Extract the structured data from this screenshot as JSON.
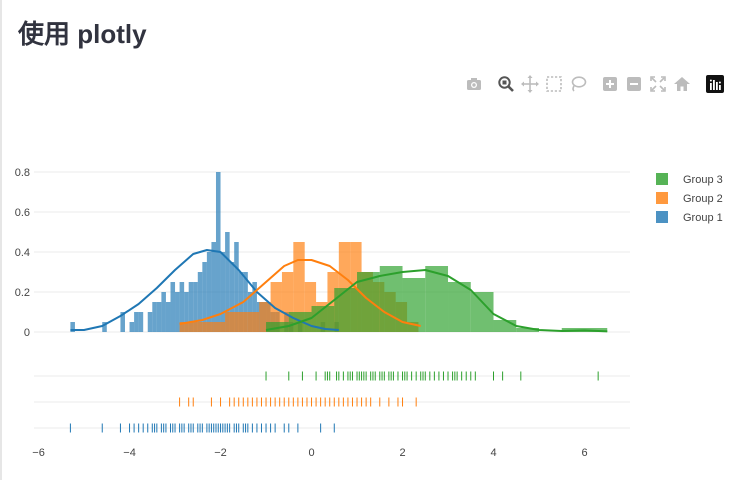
{
  "page": {
    "title": "使用 plotly"
  },
  "modebar": {
    "buttons": [
      {
        "name": "camera-icon",
        "label": "Download plot as a png"
      },
      {
        "name": "zoom-icon",
        "label": "Zoom"
      },
      {
        "name": "pan-icon",
        "label": "Pan"
      },
      {
        "name": "box-select-icon",
        "label": "Box Select"
      },
      {
        "name": "lasso-select-icon",
        "label": "Lasso Select"
      },
      {
        "name": "zoom-in-icon",
        "label": "Zoom in"
      },
      {
        "name": "zoom-out-icon",
        "label": "Zoom out"
      },
      {
        "name": "autoscale-icon",
        "label": "Autoscale"
      },
      {
        "name": "home-icon",
        "label": "Reset axes"
      },
      {
        "name": "plotly-logo-icon",
        "label": "Produced with Plotly"
      }
    ]
  },
  "chart_data": {
    "type": "histogram",
    "title": "",
    "xlabel": "",
    "ylabel": "",
    "xlim": [
      -6.1,
      7.0
    ],
    "ylim": [
      -0.02,
      0.86
    ],
    "x_ticks": [
      -6,
      -4,
      -2,
      0,
      2,
      4,
      6
    ],
    "y_ticks": [
      0,
      0.2,
      0.4,
      0.6,
      0.8
    ],
    "y_tick_labels": [
      "0",
      "0.2",
      "0.4",
      "0.6",
      "0.8"
    ],
    "grid": true,
    "legend_position": "right",
    "series": [
      {
        "name": "Group 3",
        "color": "#2ca02c",
        "bin_width": 0.5,
        "bins": [
          [
            -1.0,
            0.05
          ],
          [
            -0.5,
            0.1
          ],
          [
            0.0,
            0.13
          ],
          [
            0.5,
            0.22
          ],
          [
            1.0,
            0.3
          ],
          [
            1.5,
            0.33
          ],
          [
            2.0,
            0.27
          ],
          [
            2.5,
            0.33
          ],
          [
            3.0,
            0.25
          ],
          [
            3.5,
            0.2
          ],
          [
            4.0,
            0.06
          ],
          [
            4.5,
            0.02
          ],
          [
            5.5,
            0.02
          ],
          [
            6.0,
            0.02
          ]
        ],
        "kde": [
          [
            -1.0,
            0.01
          ],
          [
            -0.5,
            0.03
          ],
          [
            0.0,
            0.07
          ],
          [
            0.5,
            0.16
          ],
          [
            1.0,
            0.25
          ],
          [
            1.5,
            0.28
          ],
          [
            2.0,
            0.3
          ],
          [
            2.5,
            0.31
          ],
          [
            3.0,
            0.28
          ],
          [
            3.5,
            0.21
          ],
          [
            4.0,
            0.09
          ],
          [
            4.5,
            0.03
          ],
          [
            5.0,
            0.01
          ],
          [
            5.5,
            0.005
          ],
          [
            6.0,
            0.008
          ],
          [
            6.5,
            0.003
          ]
        ],
        "rug": [
          -1.0,
          -0.5,
          -0.2,
          0.1,
          0.3,
          0.35,
          0.4,
          0.55,
          0.6,
          0.7,
          0.8,
          0.85,
          0.9,
          1.0,
          1.05,
          1.1,
          1.15,
          1.2,
          1.3,
          1.35,
          1.4,
          1.5,
          1.55,
          1.6,
          1.7,
          1.75,
          1.8,
          1.9,
          2.0,
          2.05,
          2.1,
          2.2,
          2.3,
          2.4,
          2.45,
          2.5,
          2.6,
          2.7,
          2.8,
          2.9,
          3.0,
          3.1,
          3.15,
          3.2,
          3.3,
          3.4,
          3.5,
          3.6,
          4.0,
          4.2,
          4.6,
          6.3
        ]
      },
      {
        "name": "Group 2",
        "color": "#ff7f0e",
        "bin_width": 0.25,
        "bins": [
          [
            -2.9,
            0.05
          ],
          [
            -2.65,
            0.05
          ],
          [
            -2.4,
            0.05
          ],
          [
            -2.15,
            0.05
          ],
          [
            -1.9,
            0.1
          ],
          [
            -1.65,
            0.1
          ],
          [
            -1.4,
            0.1
          ],
          [
            -1.15,
            0.15
          ],
          [
            -0.9,
            0.25
          ],
          [
            -0.65,
            0.3
          ],
          [
            -0.4,
            0.45
          ],
          [
            -0.15,
            0.25
          ],
          [
            0.1,
            0.15
          ],
          [
            0.35,
            0.3
          ],
          [
            0.6,
            0.45
          ],
          [
            0.85,
            0.45
          ],
          [
            1.1,
            0.3
          ],
          [
            1.35,
            0.25
          ],
          [
            1.6,
            0.2
          ],
          [
            1.85,
            0.15
          ],
          [
            2.1,
            0.05
          ]
        ],
        "kde": [
          [
            -2.9,
            0.04
          ],
          [
            -2.4,
            0.06
          ],
          [
            -2.0,
            0.09
          ],
          [
            -1.5,
            0.15
          ],
          [
            -1.0,
            0.25
          ],
          [
            -0.6,
            0.33
          ],
          [
            -0.3,
            0.36
          ],
          [
            0.0,
            0.36
          ],
          [
            0.4,
            0.33
          ],
          [
            0.8,
            0.26
          ],
          [
            1.2,
            0.17
          ],
          [
            1.6,
            0.1
          ],
          [
            2.0,
            0.05
          ],
          [
            2.4,
            0.03
          ]
        ],
        "rug": [
          -2.9,
          -2.7,
          -2.6,
          -2.2,
          -2.0,
          -1.8,
          -1.7,
          -1.6,
          -1.5,
          -1.4,
          -1.3,
          -1.2,
          -1.1,
          -1.0,
          -0.9,
          -0.8,
          -0.7,
          -0.6,
          -0.5,
          -0.4,
          -0.3,
          -0.2,
          -0.1,
          0.0,
          0.1,
          0.2,
          0.3,
          0.4,
          0.5,
          0.6,
          0.7,
          0.8,
          0.9,
          1.0,
          1.1,
          1.2,
          1.3,
          1.5,
          1.7,
          1.9,
          2.0,
          2.3
        ]
      },
      {
        "name": "Group 1",
        "color": "#1f77b4",
        "bin_width": 0.1,
        "bins": [
          [
            -5.3,
            0.05
          ],
          [
            -4.6,
            0.05
          ],
          [
            -4.2,
            0.1
          ],
          [
            -4.0,
            0.05
          ],
          [
            -3.9,
            0.1
          ],
          [
            -3.8,
            0.1
          ],
          [
            -3.6,
            0.1
          ],
          [
            -3.5,
            0.15
          ],
          [
            -3.4,
            0.15
          ],
          [
            -3.3,
            0.2
          ],
          [
            -3.2,
            0.15
          ],
          [
            -3.1,
            0.25
          ],
          [
            -3.0,
            0.2
          ],
          [
            -2.9,
            0.25
          ],
          [
            -2.8,
            0.2
          ],
          [
            -2.7,
            0.25
          ],
          [
            -2.6,
            0.25
          ],
          [
            -2.5,
            0.3
          ],
          [
            -2.4,
            0.35
          ],
          [
            -2.3,
            0.4
          ],
          [
            -2.2,
            0.45
          ],
          [
            -2.1,
            0.8
          ],
          [
            -2.0,
            0.4
          ],
          [
            -1.9,
            0.5
          ],
          [
            -1.8,
            0.35
          ],
          [
            -1.7,
            0.45
          ],
          [
            -1.6,
            0.3
          ],
          [
            -1.5,
            0.3
          ],
          [
            -1.4,
            0.2
          ],
          [
            -1.3,
            0.25
          ],
          [
            -1.2,
            0.15
          ],
          [
            -1.1,
            0.15
          ],
          [
            -1.0,
            0.15
          ],
          [
            -0.9,
            0.1
          ],
          [
            -0.8,
            0.1
          ],
          [
            -0.6,
            0.1
          ],
          [
            -0.5,
            0.05
          ],
          [
            -0.3,
            0.05
          ],
          [
            0.2,
            0.05
          ],
          [
            0.5,
            0.05
          ]
        ],
        "kde": [
          [
            -5.3,
            0.01
          ],
          [
            -5.0,
            0.01
          ],
          [
            -4.6,
            0.03
          ],
          [
            -4.2,
            0.08
          ],
          [
            -3.8,
            0.14
          ],
          [
            -3.4,
            0.22
          ],
          [
            -3.0,
            0.31
          ],
          [
            -2.6,
            0.39
          ],
          [
            -2.3,
            0.41
          ],
          [
            -2.0,
            0.4
          ],
          [
            -1.6,
            0.31
          ],
          [
            -1.2,
            0.2
          ],
          [
            -0.8,
            0.12
          ],
          [
            -0.4,
            0.07
          ],
          [
            0.0,
            0.03
          ],
          [
            0.3,
            0.015
          ],
          [
            0.6,
            0.01
          ]
        ],
        "rug": [
          -5.3,
          -4.6,
          -4.2,
          -4.0,
          -3.9,
          -3.8,
          -3.7,
          -3.6,
          -3.5,
          -3.45,
          -3.4,
          -3.3,
          -3.25,
          -3.2,
          -3.1,
          -3.05,
          -3.0,
          -2.9,
          -2.85,
          -2.8,
          -2.7,
          -2.65,
          -2.6,
          -2.5,
          -2.45,
          -2.4,
          -2.3,
          -2.25,
          -2.2,
          -2.15,
          -2.1,
          -2.05,
          -2.0,
          -1.95,
          -1.9,
          -1.85,
          -1.8,
          -1.7,
          -1.65,
          -1.6,
          -1.5,
          -1.45,
          -1.4,
          -1.3,
          -1.2,
          -1.1,
          -1.0,
          -0.9,
          -0.8,
          -0.6,
          -0.5,
          -0.3,
          0.2,
          0.5
        ]
      }
    ]
  }
}
